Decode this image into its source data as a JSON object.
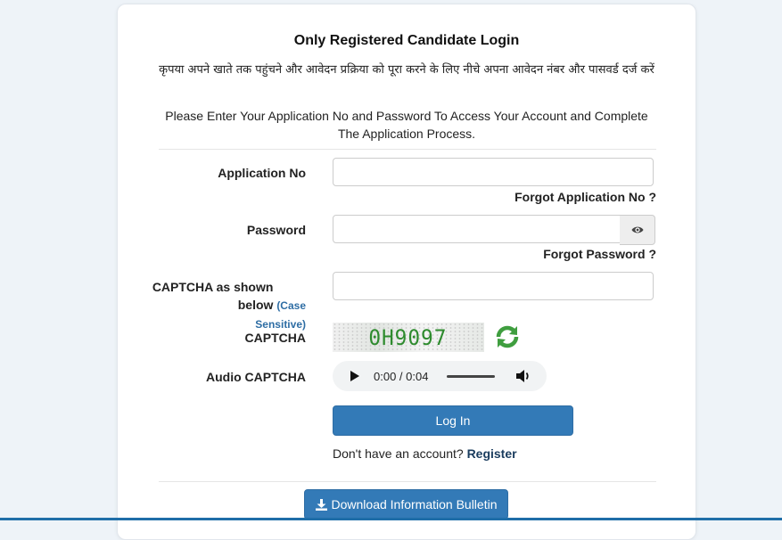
{
  "login": {
    "title": "Only Registered Candidate Login",
    "hindi_instruction": "कृपया अपने खाते तक पहुंचने और आवेदन प्रक्रिया को पूरा करने के लिए नीचे अपना आवेदन नंबर और पासवर्ड दर्ज करें",
    "english_instruction": "Please Enter Your Application No and Password To Access Your Account and Complete The Application Process.",
    "application_no_label": "Application No",
    "application_no_value": "",
    "forgot_application_no": "Forgot Application No ?",
    "password_label": "Password",
    "password_value": "",
    "forgot_password": "Forgot Password ?",
    "captcha_label_main": "CAPTCHA as shown below",
    "captcha_case_note": "(Case Sensitive)",
    "captcha_value": "",
    "captcha_image_label": "CAPTCHA",
    "captcha_text": "0H9097",
    "audio_captcha_label": "Audio CAPTCHA",
    "audio_time": "0:00 / 0:04",
    "login_button": "Log In",
    "no_account_text": "Don't have an account?",
    "register_link": "Register",
    "download_button": "Download Information Bulletin"
  },
  "icons": {
    "eye": "eye-icon",
    "refresh": "refresh-icon",
    "play": "play-icon",
    "volume": "volume-icon",
    "download": "download-icon"
  },
  "colors": {
    "primary": "#337ab7",
    "captcha_green": "#2e8b2e",
    "link_dark": "#1a3c5e"
  }
}
